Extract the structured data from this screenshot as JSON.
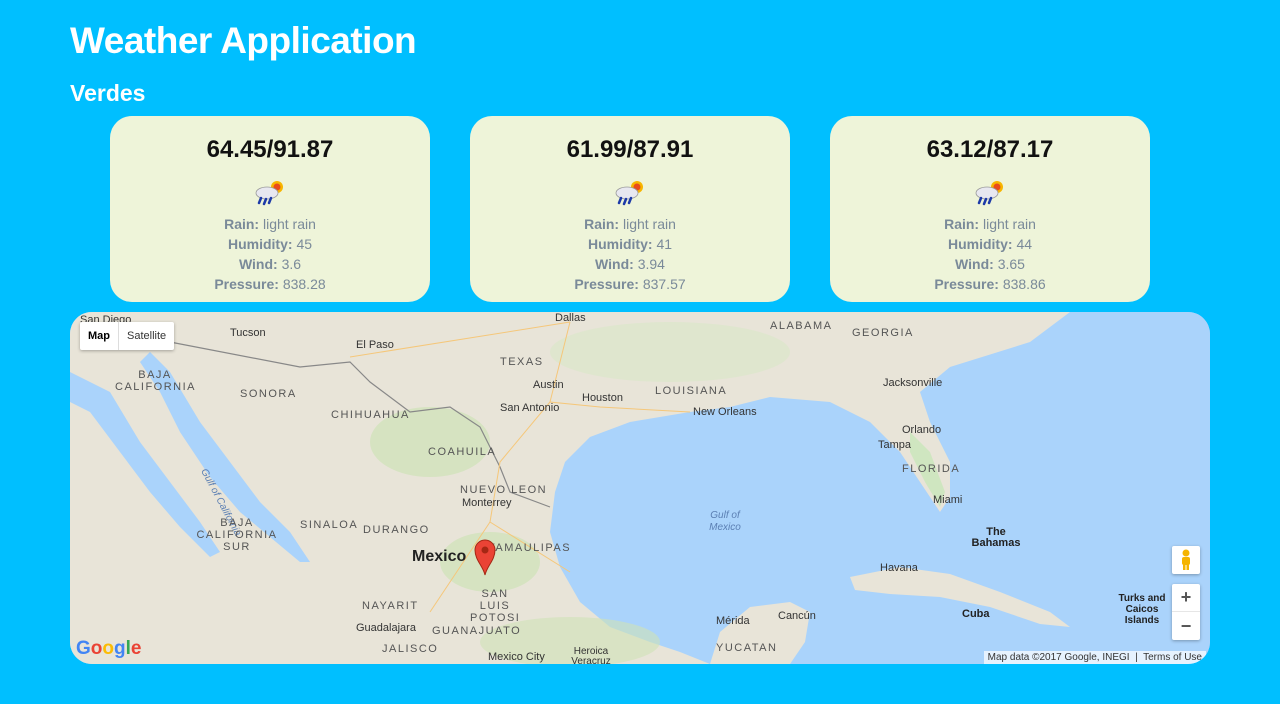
{
  "app": {
    "title": "Weather Application",
    "city": "Verdes"
  },
  "forecast": [
    {
      "temps": "64.45/91.87",
      "icon": "rain-sun-icon",
      "rain_label": "Rain:",
      "rain": "light rain",
      "humidity_label": "Humidity:",
      "humidity": "45",
      "wind_label": "Wind:",
      "wind": "3.6",
      "pressure_label": "Pressure:",
      "pressure": "838.28"
    },
    {
      "temps": "61.99/87.91",
      "icon": "rain-sun-icon",
      "rain_label": "Rain:",
      "rain": "light rain",
      "humidity_label": "Humidity:",
      "humidity": "41",
      "wind_label": "Wind:",
      "wind": "3.94",
      "pressure_label": "Pressure:",
      "pressure": "837.57"
    },
    {
      "temps": "63.12/87.17",
      "icon": "rain-sun-icon",
      "rain_label": "Rain:",
      "rain": "light rain",
      "humidity_label": "Humidity:",
      "humidity": "44",
      "wind_label": "Wind:",
      "wind": "3.65",
      "pressure_label": "Pressure:",
      "pressure": "838.86"
    }
  ],
  "map": {
    "type_buttons": {
      "map": "Map",
      "satellite": "Satellite"
    },
    "zoom_in": "+",
    "zoom_out": "−",
    "attribution": "Map data ©2017 Google, INEGI",
    "terms": "Terms of Use",
    "logo": "Google",
    "labels": {
      "san_diego": "San Diego",
      "tucson": "Tucson",
      "el_paso": "El Paso",
      "dallas": "Dallas",
      "alabama": "ALABAMA",
      "georgia": "GEORGIA",
      "texas": "TEXAS",
      "austin": "Austin",
      "louisiana": "LOUISIANA",
      "jacksonville": "Jacksonville",
      "baja_california": "BAJA CALIFORNIA",
      "sonora": "SONORA",
      "chihuahua": "CHIHUAHUA",
      "san_antonio": "San Antonio",
      "houston": "Houston",
      "new_orleans": "New Orleans",
      "orlando": "Orlando",
      "tampa": "Tampa",
      "florida": "FLORIDA",
      "gulf_california": "Gulf of California",
      "coahuila": "COAHUILA",
      "nuevo_leon": "NUEVO LEON",
      "monterrey": "Monterrey",
      "miami": "Miami",
      "baja_california_sur": "BAJA CALIFORNIA SUR",
      "sinaloa": "SINALOA",
      "durango": "DURANGO",
      "gulf_mexico": "Gulf of Mexico",
      "the_bahamas": "The Bahamas",
      "mexico": "Mexico",
      "tamaulipas": "TAMAULIPAS",
      "havana": "Havana",
      "nayarit": "NAYARIT",
      "san_luis_potosi": "SAN LUIS POTOSI",
      "turks_caicos": "Turks and Caicos Islands",
      "merida": "Mérida",
      "cancun": "Cancún",
      "cuba": "Cuba",
      "guadalajara": "Guadalajara",
      "guanajuato": "GUANAJUATO",
      "jalisco": "JALISCO",
      "mexico_city": "Mexico City",
      "heroica_veracruz": "Heroica Veracruz",
      "yucatan": "YUCATAN"
    }
  }
}
